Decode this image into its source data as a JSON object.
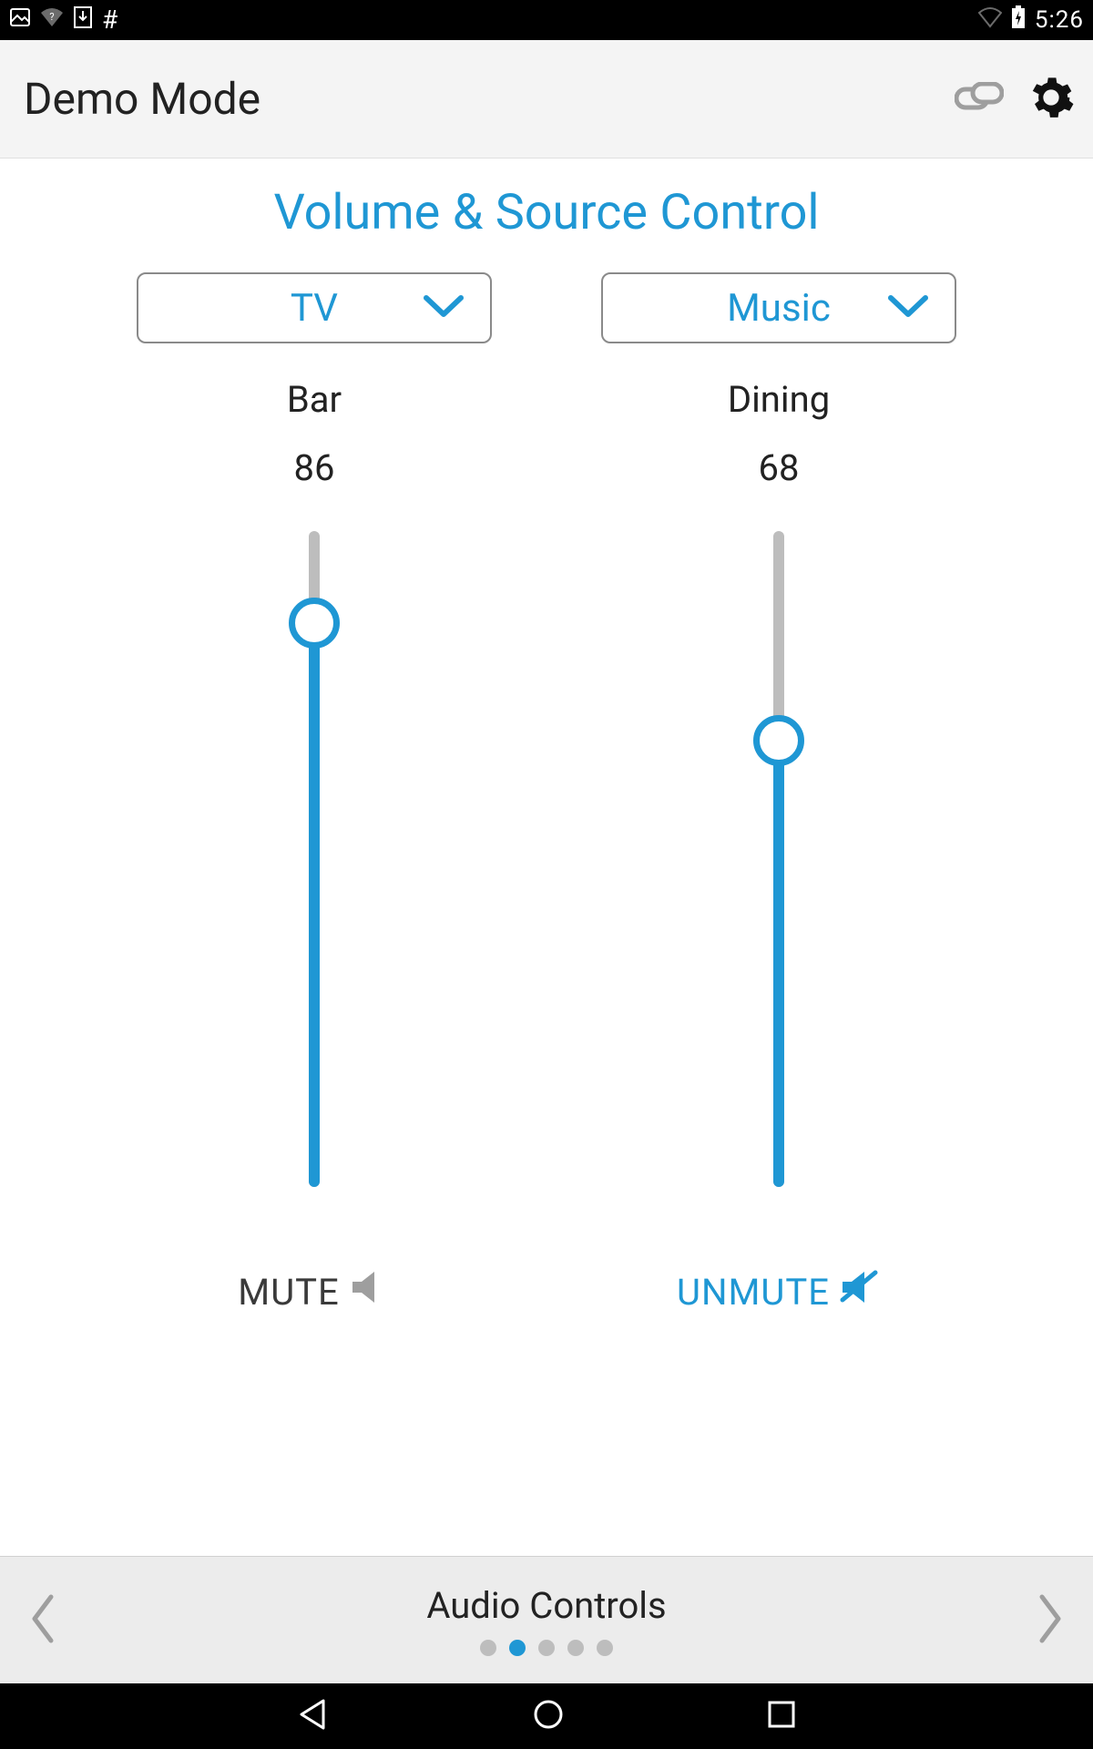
{
  "colors": {
    "accent": "#1f97d4",
    "muted_grey": "#9e9e9e"
  },
  "status_bar": {
    "time": "5:26"
  },
  "header": {
    "title": "Demo Mode"
  },
  "page": {
    "title": "Volume & Source Control",
    "nav_label": "Audio Controls",
    "page_index": 1,
    "page_count": 5
  },
  "zones": [
    {
      "source": "TV",
      "name": "Bar",
      "value": 86,
      "mute_label": "MUTE",
      "muted": false
    },
    {
      "source": "Music",
      "name": "Dining",
      "value": 68,
      "mute_label": "UNMUTE",
      "muted": true
    }
  ]
}
